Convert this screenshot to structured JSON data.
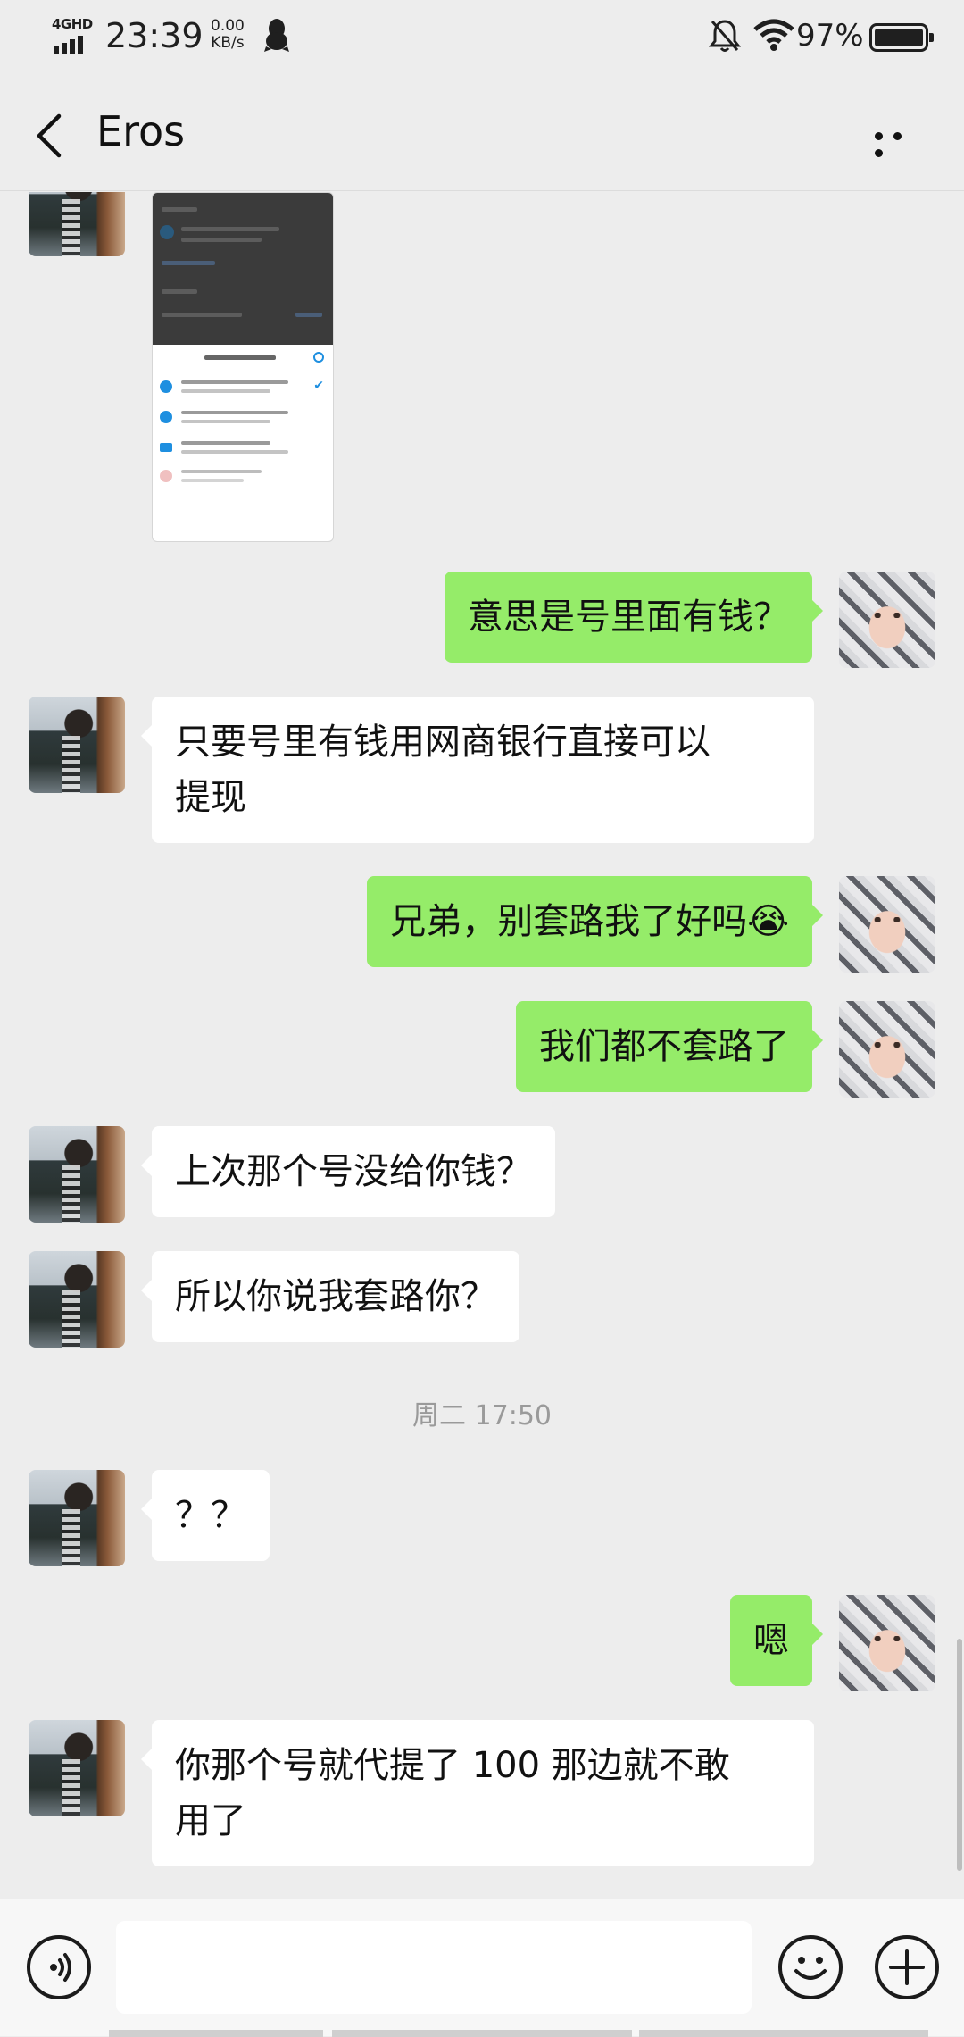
{
  "status_bar": {
    "network": "4GHD",
    "time": "23:39",
    "speed_value": "0.00",
    "speed_unit": "KB/s",
    "battery": "97%"
  },
  "header": {
    "title": "Eros"
  },
  "messages": [
    {
      "from": "other",
      "type": "image"
    },
    {
      "from": "me",
      "text": "意思是号里面有钱？"
    },
    {
      "from": "other",
      "line1": "只要号里有钱用网商银行直接可以",
      "line2": "提现"
    },
    {
      "from": "me",
      "text": "兄弟，别套路我了好吗😭"
    },
    {
      "from": "me",
      "text": "我们都不套路了"
    },
    {
      "from": "other",
      "text": "上次那个号没给你钱？"
    },
    {
      "from": "other",
      "text": "所以你说我套路你？"
    },
    {
      "from": "other",
      "text": "？？"
    },
    {
      "from": "me",
      "text": "嗯"
    },
    {
      "from": "other",
      "line1": "你那个号就代提了 100 那边就不敢",
      "line2": "用了"
    }
  ],
  "timestamp": "周二 17:50",
  "input": {
    "placeholder": ""
  }
}
